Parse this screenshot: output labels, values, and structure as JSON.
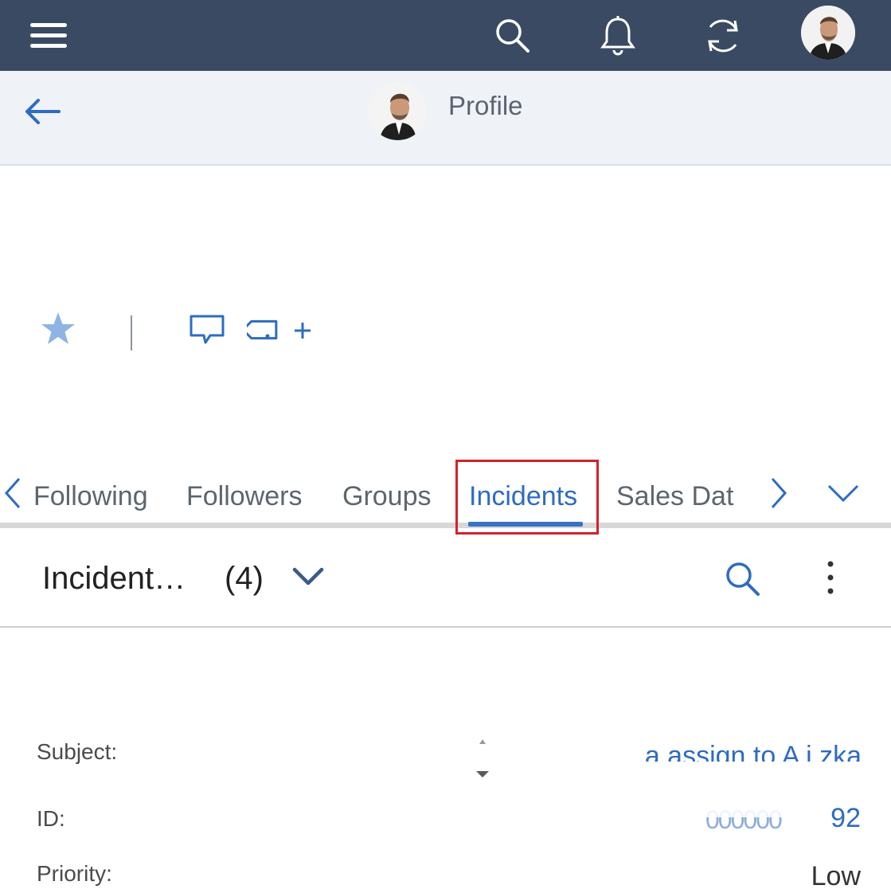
{
  "header": {
    "title": "Profile"
  },
  "profile": {
    "name_partial": "' ' ' ' ' ' '"
  },
  "tabs": [
    {
      "label": "Following"
    },
    {
      "label": "Followers"
    },
    {
      "label": "Groups"
    },
    {
      "label": "Incidents"
    },
    {
      "label": "Sales Dat"
    }
  ],
  "active_tab": "Incidents",
  "list": {
    "title": "Incident…",
    "count": "(4)"
  },
  "record": {
    "subject_label": "Subject:",
    "subject_value": "a assign to A  i  zka",
    "id_label": "ID:",
    "id_value": "92",
    "priority_label": "Priority:",
    "priority_value": "Low"
  },
  "colors": {
    "topbar": "#3a4a63",
    "accent": "#2e6cc0",
    "highlight": "#d2232a"
  }
}
